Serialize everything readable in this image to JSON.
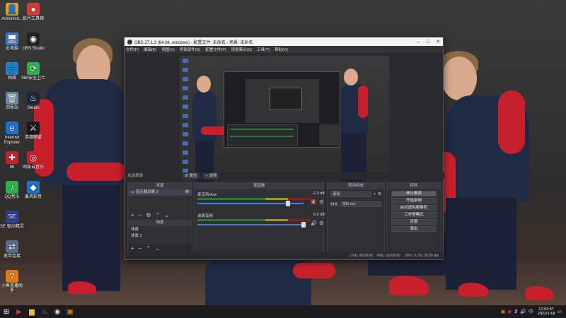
{
  "desktop": {
    "icons": [
      {
        "label": "Administr...",
        "icon": "user-folder-icon",
        "color": "#d9a43a",
        "glyph": "👤"
      },
      {
        "label": "此电脑",
        "icon": "computer-icon",
        "color": "#3a7fd0",
        "glyph": "🖥"
      },
      {
        "label": "网络",
        "icon": "network-icon",
        "color": "#3a7fd0",
        "glyph": "🌐"
      },
      {
        "label": "回收站",
        "icon": "recycle-bin-icon",
        "color": "#6a8fb0",
        "glyph": "🗑"
      },
      {
        "label": "Internet Explorer",
        "icon": "ie-icon",
        "color": "#1e6fd0",
        "glyph": "e"
      },
      {
        "label": "hh",
        "icon": "red-app-icon",
        "color": "#c8202b",
        "glyph": "✚"
      },
      {
        "label": "QQ音乐",
        "icon": "qq-music-icon",
        "color": "#2bb24c",
        "glyph": "♪"
      },
      {
        "label": "SE 驱动精灵",
        "icon": "se-icon",
        "color": "#2f3f8f",
        "glyph": "SE"
      },
      {
        "label": "宽带连接",
        "icon": "broadband-icon",
        "color": "#5a6a8a",
        "glyph": "⇄"
      },
      {
        "label": "小鱼直播助手",
        "icon": "fish-app-icon",
        "color": "#e07a1a",
        "glyph": "?"
      }
    ],
    "icons_col2": [
      {
        "label": "影片工具箱",
        "icon": "red-button-icon",
        "color": "#d83a3a",
        "glyph": "●"
      },
      {
        "label": "OBS Studio",
        "icon": "obs-icon",
        "color": "#222222",
        "glyph": "◉"
      },
      {
        "label": "360安全卫士",
        "icon": "360-icon",
        "color": "#2bb24c",
        "glyph": "⟳"
      },
      {
        "label": "Steam",
        "icon": "steam-icon",
        "color": "#1b2838",
        "glyph": "♨"
      },
      {
        "label": "英雄联盟",
        "icon": "game-icon",
        "color": "#1a1a1a",
        "glyph": "⚔"
      },
      {
        "label": "网易云音乐",
        "icon": "netease-icon",
        "color": "#c8202b",
        "glyph": "◎"
      },
      {
        "label": "暴风影音",
        "icon": "storm-icon",
        "color": "#1e6fd0",
        "glyph": "◆"
      }
    ]
  },
  "obs": {
    "title": "OBS 27.1.3 (64-bit, windows) - 配置文件: 未命名 - 场景: 未命名",
    "menu": [
      "文件(F)",
      "编辑(E)",
      "视图(V)",
      "停靠部件(D)",
      "配置文件(P)",
      "场景集合(S)",
      "工具(T)",
      "帮助(H)"
    ],
    "scene_label": "未选择源",
    "tabs": [
      "属性",
      "滤镜"
    ],
    "sources": {
      "header": "来源",
      "items": [
        "显示器采集 2"
      ]
    },
    "scenes": {
      "header": "场景",
      "items": [
        "场景",
        "场景 2"
      ]
    },
    "mixer": {
      "header": "混音器",
      "tracks": [
        {
          "name": "麦克风/Aux",
          "db": "-2.3 dB",
          "level": 0.85
        },
        {
          "name": "桌面音频",
          "db": "0.0 dB",
          "level": 1.0
        }
      ]
    },
    "transitions": {
      "header": "转场特效",
      "type": "渐变",
      "duration_label": "时长",
      "duration": "300 ms"
    },
    "controls": {
      "header": "控件",
      "buttons": [
        "停止推流",
        "开始录制",
        "启动虚拟摄像机",
        "工作室模式",
        "设置",
        "退出"
      ]
    },
    "status": {
      "live": "LIVE: 00:00:00",
      "rec": "REC: 00:00:00",
      "cpu": "CPU: 0.7%, 30.00 fps"
    }
  },
  "taskbar": {
    "time": "17:03:57",
    "date": "2022/1/18",
    "apps": [
      "start-icon",
      "video-app-icon",
      "folder-icon",
      "steam-taskbar-icon",
      "obs-taskbar-icon",
      "fish-taskbar-icon"
    ]
  }
}
